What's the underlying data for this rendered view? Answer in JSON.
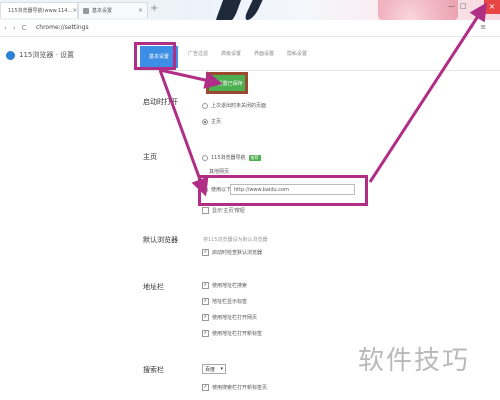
{
  "tabs": [
    {
      "label": "115浏览器导航(www.114..."
    },
    {
      "label": "基本设置"
    }
  ],
  "address": {
    "url": "chrome://settings"
  },
  "window": {
    "minimize": "—",
    "maximize": "□",
    "close": "×",
    "menu": "≡"
  },
  "app": {
    "logo_text": "115浏览器 · 设置"
  },
  "nav_tabs": [
    "基本设置",
    "广告过滤",
    "高级设置",
    "界面设置",
    "隐私设置"
  ],
  "saved_badge": "设置已保存",
  "sections": {
    "startup": {
      "label": "启动时打开",
      "options": [
        "上次退出时未关闭的页面",
        "主页"
      ]
    },
    "homepage": {
      "label": "主页",
      "nav_option": "115浏览器导航",
      "nav_tag": "推荐",
      "sub_label": "其他网页",
      "custom_option": "使用以下:",
      "custom_value": "http://www.baidu.com",
      "extra_option": "显示'主页'按钮"
    },
    "default_browser": {
      "label": "默认浏览器",
      "note": "将115浏览器设为默认浏览器",
      "option": "启动时检查默认浏览器"
    },
    "address_bar": {
      "label": "地址栏",
      "options": [
        "使用地址栏搜索",
        "地址栏显示标签",
        "使用地址栏打开网页",
        "使用地址栏打开新标签"
      ]
    },
    "search_bar": {
      "label": "搜索栏",
      "select_value": "百度",
      "option": "使用搜索栏打开新标签页"
    }
  },
  "watermark": "软件技巧",
  "colors": {
    "highlight": "#b02e86",
    "accent": "#3d8ee6",
    "saved": "#4caf50"
  }
}
